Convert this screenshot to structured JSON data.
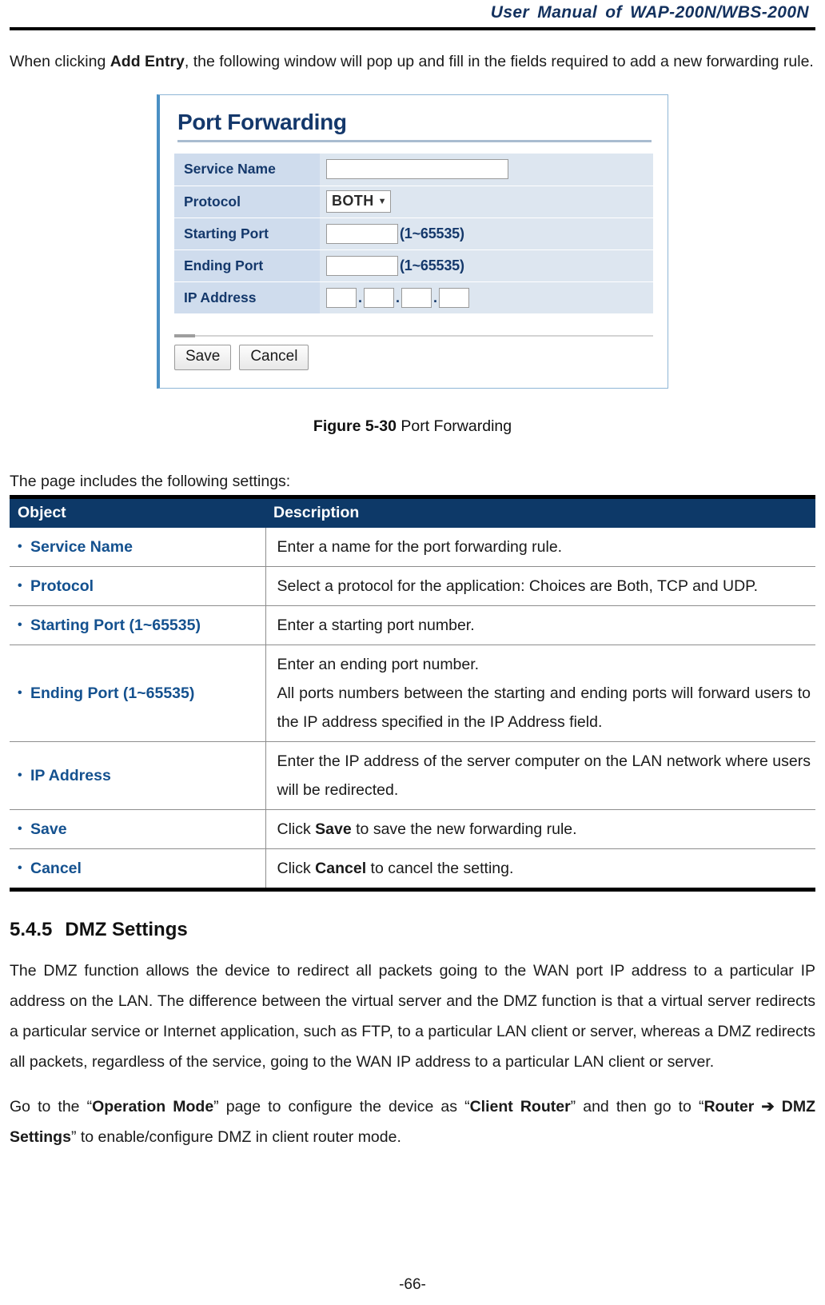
{
  "header": {
    "running_title": "User Manual of WAP-200N/WBS-200N"
  },
  "intro_paragraph": {
    "before": "When clicking ",
    "bold": "Add Entry",
    "after": ", the following window will pop up and fill in the fields required to add a new forwarding rule."
  },
  "figure": {
    "dialog": {
      "title": "Port Forwarding",
      "fields": [
        {
          "label": "Service Name",
          "value": "",
          "hint": ""
        },
        {
          "label": "Protocol",
          "value": "BOTH",
          "hint": ""
        },
        {
          "label": "Starting Port",
          "value": "",
          "hint": "(1~65535)"
        },
        {
          "label": "Ending Port",
          "value": "",
          "hint": "(1~65535)"
        },
        {
          "label": "IP Address",
          "value": "",
          "hint": ""
        }
      ],
      "protocol_selected": "BOTH",
      "protocol_caret": "▼",
      "ip_octets": [
        "",
        "",
        "",
        ""
      ],
      "ip_separator": ".",
      "buttons": {
        "save": "Save",
        "cancel": "Cancel"
      }
    },
    "caption_label": "Figure 5-30",
    "caption_text": "Port Forwarding"
  },
  "settings_intro": "The page includes the following settings:",
  "settings_table": {
    "headers": {
      "object": "Object",
      "description": "Description"
    },
    "rows": [
      {
        "object": "Service Name",
        "lines": [
          {
            "pre": "Enter a name for the port forwarding rule.",
            "bold": "",
            "post": ""
          }
        ]
      },
      {
        "object": "Protocol",
        "lines": [
          {
            "pre": "Select a protocol for the application: Choices are Both, TCP and UDP.",
            "bold": "",
            "post": ""
          }
        ]
      },
      {
        "object": "Starting Port (1~65535)",
        "lines": [
          {
            "pre": "Enter a starting port number.",
            "bold": "",
            "post": ""
          }
        ]
      },
      {
        "object": "Ending Port (1~65535)",
        "lines": [
          {
            "pre": "Enter an ending port number.",
            "bold": "",
            "post": ""
          },
          {
            "pre": "All ports numbers between the starting and ending ports will forward users to the IP address specified in the IP Address field.",
            "bold": "",
            "post": ""
          }
        ]
      },
      {
        "object": "IP Address",
        "lines": [
          {
            "pre": "Enter the IP address of the server computer on the LAN network where users will be redirected.",
            "bold": "",
            "post": ""
          }
        ]
      },
      {
        "object": "Save",
        "lines": [
          {
            "pre": "Click ",
            "bold": "Save",
            "post": " to save the new forwarding rule."
          }
        ]
      },
      {
        "object": "Cancel",
        "lines": [
          {
            "pre": "Click ",
            "bold": "Cancel",
            "post": " to cancel the setting."
          }
        ]
      }
    ]
  },
  "section": {
    "number": "5.4.5",
    "title": "DMZ Settings",
    "paragraph": "The DMZ function allows the device to redirect all packets going to the WAN port IP address to a particular IP address on the LAN. The difference between the virtual server and the DMZ function is that a virtual server redirects a particular service or Internet application, such as FTP, to a particular LAN client or server, whereas a DMZ redirects all packets, regardless of the service, going to the WAN IP address to a particular LAN client or server.",
    "goto_paragraph": {
      "p1": "Go to the “",
      "b1": "Operation Mode",
      "p2": "” page to configure the device as “",
      "b2": "Client Router",
      "p3": "” and then go to “",
      "b3": "Router ➔ DMZ Settings",
      "p4": "” to enable/configure DMZ in client router mode."
    }
  },
  "page_number": "-66-"
}
